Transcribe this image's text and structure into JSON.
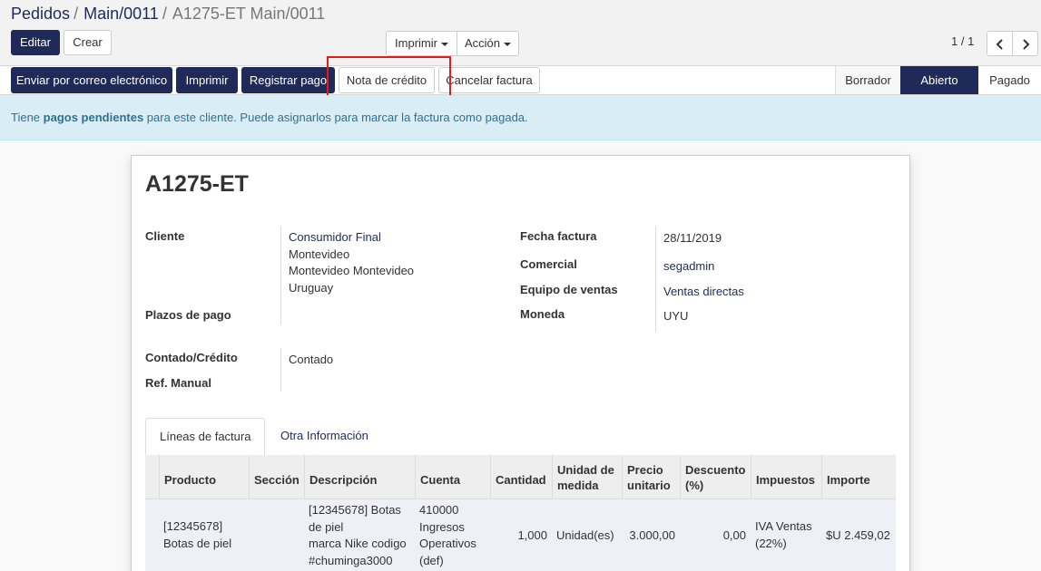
{
  "breadcrumb": {
    "items": [
      "Pedidos",
      "Main/0011"
    ],
    "current": "A1275-ET Main/0011",
    "separator": "/"
  },
  "toolbar": {
    "edit_label": "Editar",
    "create_label": "Crear",
    "print_label": "Imprimir",
    "action_label": "Acción"
  },
  "pager": {
    "value": "1 / 1"
  },
  "statusbar": {
    "buttons": [
      "Enviar por correo electrónico",
      "Imprimir",
      "Registrar pago",
      "Nota de crédito",
      "Cancelar factura"
    ],
    "stages": [
      "Borrador",
      "Abierto",
      "Pagado"
    ],
    "active_stage": "Abierto"
  },
  "alert": {
    "prefix": "Tiene ",
    "bold": "pagos pendientes",
    "suffix": " para este cliente. Puede asignarlos para marcar la factura como pagada."
  },
  "invoice": {
    "name": "A1275-ET",
    "left_fields": {
      "cliente_label": "Cliente",
      "cliente_name": "Consumidor Final",
      "cliente_city": "Montevideo",
      "cliente_state": "Montevideo Montevideo",
      "cliente_country": "Uruguay",
      "plazos_label": "Plazos de pago",
      "contado_label": "Contado/Crédito",
      "contado_value": "Contado",
      "ref_label": "Ref. Manual"
    },
    "right_fields": {
      "fecha_label": "Fecha factura",
      "fecha_value": "28/11/2019",
      "comercial_label": "Comercial",
      "comercial_value": "segadmin",
      "equipo_label": "Equipo de ventas",
      "equipo_value": "Ventas directas",
      "moneda_label": "Moneda",
      "moneda_value": "UYU"
    }
  },
  "tabs": [
    "Líneas de factura",
    "Otra Información"
  ],
  "lines_table": {
    "headers": {
      "producto": "Producto",
      "seccion": "Sección",
      "descripcion": "Descripción",
      "cuenta": "Cuenta",
      "cantidad": "Cantidad",
      "unidad_1": "Unidad de",
      "unidad_2": "medida",
      "precio_1": "Precio",
      "precio_2": "unitario",
      "descuento_1": "Descuento",
      "descuento_2": "(%)",
      "impuestos": "Impuestos",
      "importe": "Importe"
    },
    "row": {
      "producto_1": "[12345678]",
      "producto_2": "Botas de piel",
      "seccion": "",
      "descripcion_1": "[12345678] Botas",
      "descripcion_2": "de piel",
      "descripcion_3": "marca Nike codigo",
      "descripcion_4": "#chuminga3000",
      "cuenta_1": "410000",
      "cuenta_2": "Ingresos",
      "cuenta_3": "Operativos",
      "cuenta_4": "(def)",
      "cantidad": "1,000",
      "unidad": "Unidad(es)",
      "precio": "3.000,00",
      "descuento": "0,00",
      "impuestos_1": "IVA Ventas",
      "impuestos_2": "(22%)",
      "importe": "$U 2.459,02"
    }
  },
  "colors": {
    "brand": "#1f2a59",
    "alert_bg": "#d9edf7",
    "alert_text": "#31708f",
    "highlight": "#e21b1b"
  },
  "icons": {
    "pager_prev": "chevron-left-icon",
    "pager_next": "chevron-right-icon"
  }
}
